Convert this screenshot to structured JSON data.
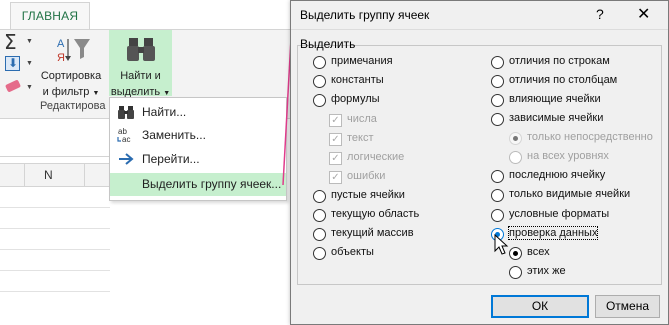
{
  "ribbon": {
    "tab_home": "ГЛАВНАЯ",
    "sort_filter_line1": "Сортировка",
    "sort_filter_line2": "и фильтр",
    "find_select_line1": "Найти и",
    "find_select_line2": "выделить",
    "group_label": "Редактирова",
    "accent_color": "#217346",
    "highlight_color": "#c6efce"
  },
  "sheet": {
    "column_header": "N"
  },
  "menu": {
    "items": [
      {
        "label": "Найти...",
        "icon": "binoculars-icon"
      },
      {
        "label": "Заменить...",
        "icon": "replace-icon"
      },
      {
        "label": "Перейти...",
        "icon": "arrow-right-icon"
      },
      {
        "label": "Выделить группу ячеек...",
        "icon": ""
      }
    ]
  },
  "dialog": {
    "title": "Выделить группу ячеек",
    "help": "?",
    "close": "✕",
    "group_label": "Выделить",
    "left_options": [
      {
        "label": "примечания",
        "selected": false
      },
      {
        "label": "константы",
        "selected": false
      },
      {
        "label": "формулы",
        "selected": false
      },
      {
        "label": "числа",
        "type": "checkbox",
        "checked": true,
        "disabled": true
      },
      {
        "label": "текст",
        "type": "checkbox",
        "checked": true,
        "disabled": true
      },
      {
        "label": "логические",
        "type": "checkbox",
        "checked": true,
        "disabled": true
      },
      {
        "label": "ошибки",
        "type": "checkbox",
        "checked": true,
        "disabled": true
      },
      {
        "label": "пустые ячейки",
        "selected": false
      },
      {
        "label": "текущую область",
        "selected": false
      },
      {
        "label": "текущий массив",
        "selected": false
      },
      {
        "label": "объекты",
        "selected": false
      }
    ],
    "right_options": [
      {
        "label": "отличия по строкам",
        "selected": false
      },
      {
        "label": "отличия по столбцам",
        "selected": false
      },
      {
        "label": "влияющие ячейки",
        "selected": false
      },
      {
        "label": "зависимые ячейки",
        "selected": false
      },
      {
        "label": "только непосредственно",
        "selected": true,
        "disabled": true
      },
      {
        "label": "на всех уровнях",
        "selected": false,
        "disabled": true
      },
      {
        "label": "последнюю ячейку",
        "selected": false
      },
      {
        "label": "только видимые ячейки",
        "selected": false
      },
      {
        "label": "условные форматы",
        "selected": false
      },
      {
        "label": "проверка данных",
        "selected": true
      },
      {
        "label": "всех",
        "selected": true
      },
      {
        "label": "этих же",
        "selected": false
      }
    ],
    "ok_label": "ОК",
    "cancel_label": "Отмена"
  }
}
